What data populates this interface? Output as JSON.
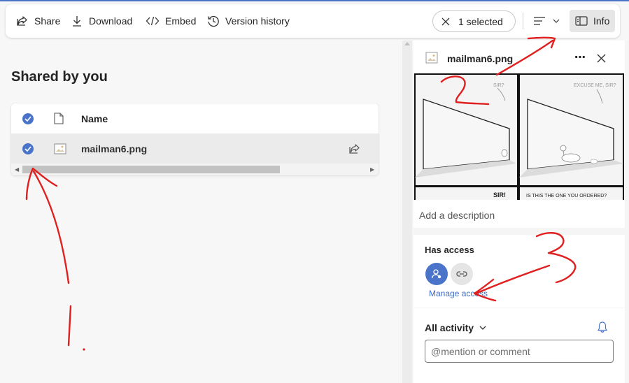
{
  "toolbar": {
    "share_label": "Share",
    "download_label": "Download",
    "embed_label": "Embed",
    "version_history_label": "Version history",
    "selection_label": "1 selected",
    "info_label": "Info"
  },
  "main": {
    "section_title": "Shared by you",
    "table": {
      "column_name": "Name",
      "rows": [
        {
          "name": "mailman6.png",
          "selected": true
        }
      ]
    }
  },
  "panel": {
    "file_name": "mailman6.png",
    "more_label": "⋯",
    "preview_captions": {
      "panel1": "SIR?",
      "panel2": "EXCUSE ME, SIR?",
      "panel3": "SIR!",
      "panel4": "IS THIS THE ONE YOU ORDERED?"
    },
    "description_placeholder": "Add a description",
    "has_access_title": "Has access",
    "manage_access_label": "Manage access",
    "activity_title": "All activity",
    "comment_placeholder": "@mention or comment"
  },
  "annotations": {
    "labels": [
      "1.",
      "2",
      "3"
    ],
    "color": "#e02020"
  },
  "colors": {
    "accent": "#4a74c9",
    "link": "#3b6bc8"
  }
}
